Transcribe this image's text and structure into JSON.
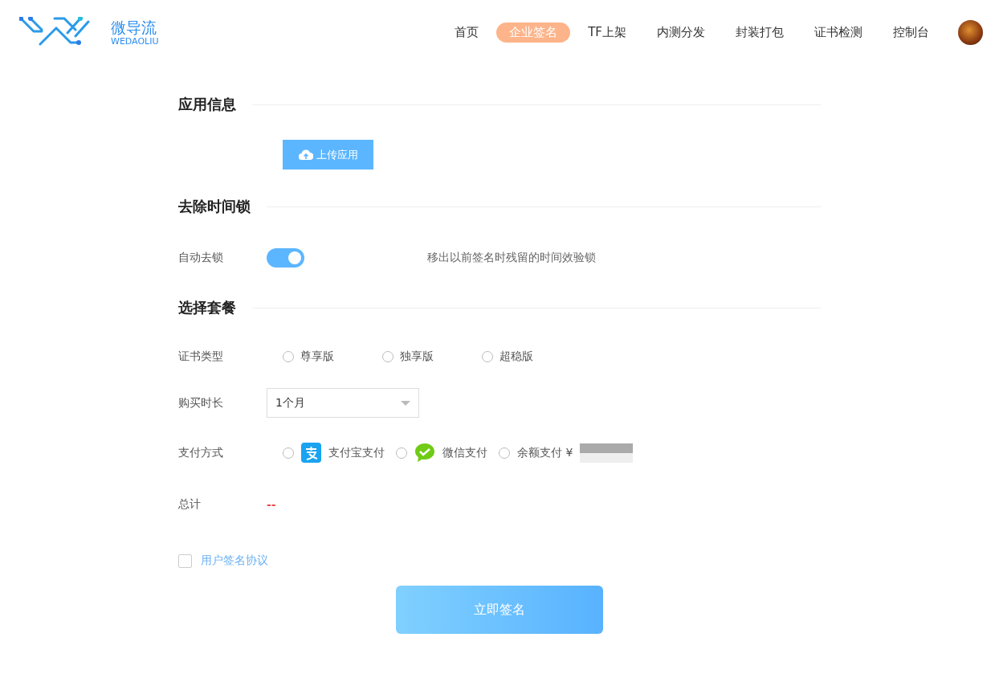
{
  "header": {
    "logo": {
      "name": "微导流",
      "subtitle": "WEDAOLIU"
    },
    "nav": [
      {
        "label": "首页",
        "selected": false
      },
      {
        "label": "企业签名",
        "selected": true
      },
      {
        "label": "TF上架",
        "selected": false
      },
      {
        "label": "内测分发",
        "selected": false
      },
      {
        "label": "封装打包",
        "selected": false
      },
      {
        "label": "证书检测",
        "selected": false
      },
      {
        "label": "控制台",
        "selected": false
      }
    ]
  },
  "app_info": {
    "title": "应用信息",
    "upload_button": "上传应用"
  },
  "time_lock": {
    "title": "去除时间锁",
    "auto_unlock": {
      "label": "自动去锁",
      "on": true,
      "description": "移出以前签名时残留的时间效验锁"
    }
  },
  "package": {
    "title": "选择套餐",
    "cert_type": {
      "label": "证书类型",
      "options": [
        {
          "label": "尊享版",
          "selected": false
        },
        {
          "label": "独享版",
          "selected": false
        },
        {
          "label": "超稳版",
          "selected": false
        }
      ]
    },
    "duration": {
      "label": "购买时长",
      "value": "1个月"
    },
    "payment": {
      "label": "支付方式",
      "options": [
        {
          "kind": "alipay",
          "label": "支付宝支付",
          "selected": false
        },
        {
          "kind": "wechat",
          "label": "微信支付",
          "selected": false
        },
        {
          "kind": "balance",
          "label": "余额支付 ¥",
          "selected": false
        }
      ]
    },
    "total": {
      "label": "总计",
      "value": "--"
    }
  },
  "agreement": {
    "label": "用户签名协议",
    "checked": false
  },
  "submit_button": "立即签名"
}
